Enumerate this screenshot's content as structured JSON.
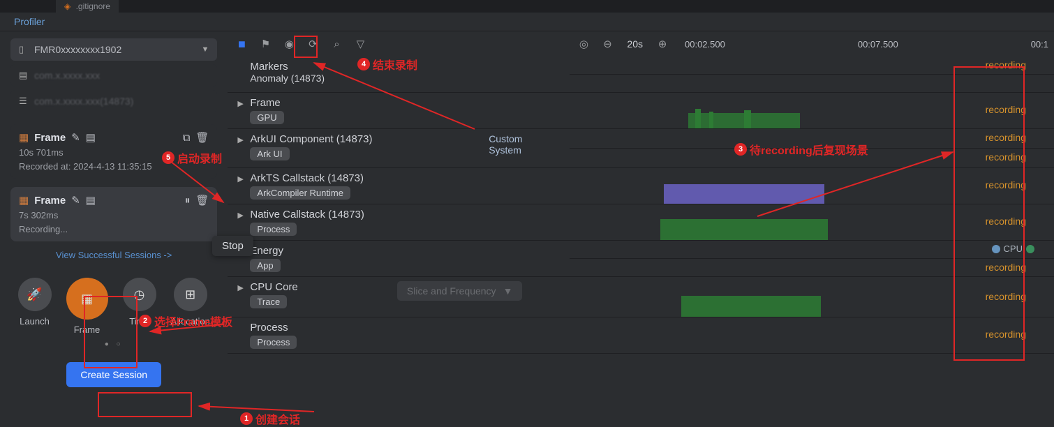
{
  "top_tab": {
    "icon": "◈",
    "name": ".gitignore"
  },
  "profiler_tab": "Profiler",
  "device": {
    "name": "FMR0xxxxxxxx1902"
  },
  "app1": {
    "name": "com.x.xxxx.xxx"
  },
  "app2": {
    "name": "com.x.xxxx.xxx(14873)"
  },
  "sessions": [
    {
      "name": "Frame",
      "duration": "10s 701ms",
      "recorded_at": "Recorded at: 2024-4-13 11:35:15"
    },
    {
      "name": "Frame",
      "duration": "7s 302ms",
      "status": "Recording..."
    }
  ],
  "stop_tooltip": "Stop",
  "view_successful": "View Successful Sessions ->",
  "templates": [
    {
      "label": "Launch",
      "glyph": "🚀"
    },
    {
      "label": "Frame",
      "glyph": "▦"
    },
    {
      "label": "Time",
      "glyph": "◷"
    },
    {
      "label": "Allocation",
      "glyph": "⊞"
    }
  ],
  "create_session": "Create Session",
  "toolbar": {
    "zoom_label": "20s"
  },
  "ruler": {
    "t1": "00:02.500",
    "t2": "00:07.500",
    "t3": "00:1"
  },
  "tracks": {
    "markers": {
      "title": "Markers",
      "sub_title": "Anomaly (14873)"
    },
    "frame": {
      "title": "Frame",
      "tag": "GPU"
    },
    "arkui": {
      "title": "ArkUI Component (14873)",
      "tag": "Ark UI",
      "aux1": "Custom",
      "aux2": "System"
    },
    "arkts": {
      "title": "ArkTS Callstack (14873)",
      "tag": "ArkCompiler Runtime"
    },
    "native": {
      "title": "Native Callstack (14873)",
      "tag": "Process"
    },
    "energy": {
      "title": "Energy",
      "tag": "App",
      "cpu": "CPU"
    },
    "cpucore": {
      "title": "CPU Core",
      "tag": "Trace",
      "slice": "Slice and Frequency"
    },
    "process": {
      "title": "Process",
      "tag": "Process"
    }
  },
  "recording_text": "recording",
  "annotations": {
    "a1": "创建会话",
    "a2": "选择Frame模板",
    "a3": "待recording后复现场景",
    "a4": "结束录制",
    "a5": "启动录制"
  },
  "chart_data": {
    "type": "area",
    "note": "Profiler timeline lanes while recording; waveforms are live activity indicators, no numeric axes shown.",
    "time_window_shown": {
      "start": "00:02.500",
      "mid": "00:07.500",
      "clipped_end": "00:1..."
    },
    "lanes": [
      {
        "name": "Markers / Anomaly (14873)",
        "status": "recording",
        "waveform": "none-visible"
      },
      {
        "name": "Frame / GPU",
        "status": "recording",
        "waveform": "green low-activity cluster approx 00:05–00:08"
      },
      {
        "name": "ArkUI Component / Ark UI (Custom)",
        "status": "recording",
        "waveform": "none-visible"
      },
      {
        "name": "ArkUI Component / Ark UI (System)",
        "status": "recording",
        "waveform": "none-visible"
      },
      {
        "name": "ArkTS Callstack / ArkCompiler Runtime",
        "status": "recording",
        "waveform": "purple dense block approx 00:04–00:09"
      },
      {
        "name": "Native Callstack / Process",
        "status": "recording",
        "waveform": "green dense block approx 00:04–00:09"
      },
      {
        "name": "Energy / App",
        "status": "recording",
        "legend": [
          "CPU"
        ],
        "waveform": "none-visible"
      },
      {
        "name": "CPU Core / Trace",
        "status": "recording",
        "waveform": "green dense block approx 00:05–00:09"
      },
      {
        "name": "Process / Process",
        "status": "recording",
        "waveform": "none-visible"
      }
    ]
  }
}
